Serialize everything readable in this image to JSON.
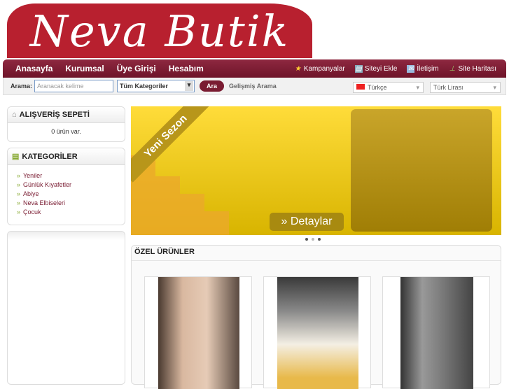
{
  "logo": "Neva Butik",
  "nav": {
    "left": [
      "Anasayfa",
      "Kurumsal",
      "Üye Girişi",
      "Hesabım"
    ],
    "right": [
      {
        "label": "Kampanyalar",
        "icon": "star-icon"
      },
      {
        "label": "Siteyi Ekle",
        "icon": "bookmark-icon"
      },
      {
        "label": "İletişim",
        "icon": "mail-icon"
      },
      {
        "label": "Site Haritası",
        "icon": "sitemap-icon"
      }
    ]
  },
  "search": {
    "label": "Arama:",
    "placeholder": "Aranacak kelime",
    "category": "Tüm Kategoriler",
    "button": "Ara",
    "advanced": "Gelişmiş Arama",
    "language": "Türkçe",
    "currency": "Türk Lirası"
  },
  "cart": {
    "title": "ALIŞVERİŞ SEPETİ",
    "text": "0 ürün var."
  },
  "categories": {
    "title": "KATEGORİLER",
    "items": [
      "Yeniler",
      "Günlük Kıyafetler",
      "Abiye",
      "Neva Elbiseleri",
      "Çocuk"
    ]
  },
  "banner": {
    "ribbon": "Yeni Sezon",
    "button": "Detaylar"
  },
  "featured": {
    "title": "ÖZEL ÜRÜNLER"
  }
}
